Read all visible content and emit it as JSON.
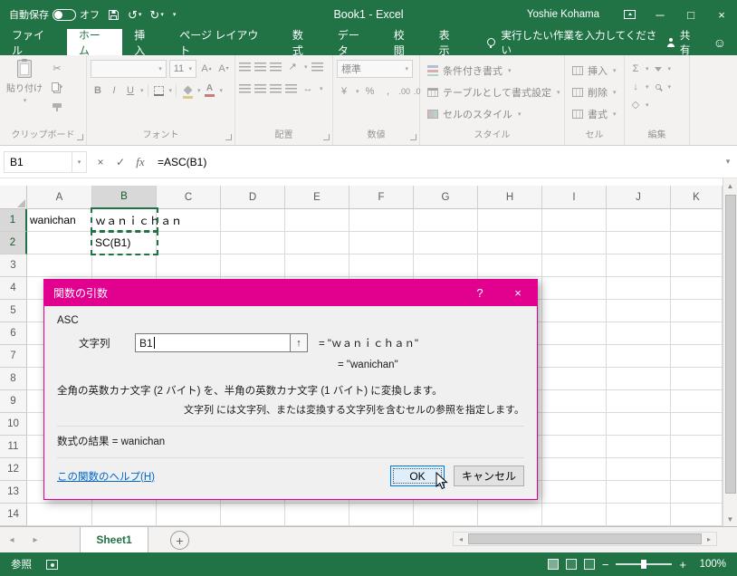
{
  "colors": {
    "excel_green": "#217346",
    "dialog_magenta": "#E2008F",
    "focus_blue": "#0078D7"
  },
  "title_bar": {
    "autosave_label": "自動保存",
    "autosave_state": "オフ",
    "workbook_title": "Book1 - Excel",
    "user_name": "Yoshie Kohama"
  },
  "tabs": {
    "file": "ファイル",
    "items": [
      {
        "label": "ホーム"
      },
      {
        "label": "挿入"
      },
      {
        "label": "ページ レイアウト"
      },
      {
        "label": "数式"
      },
      {
        "label": "データ"
      },
      {
        "label": "校閲"
      },
      {
        "label": "表示"
      }
    ],
    "tell_me": "実行したい作業を入力してください",
    "share": "共有"
  },
  "ribbon": {
    "paste": "貼り付け",
    "font_size": "11",
    "number_format": "標準",
    "style_buttons": [
      "条件付き書式",
      "テーブルとして書式設定",
      "セルのスタイル"
    ],
    "cell_buttons": [
      "挿入",
      "削除",
      "書式"
    ],
    "group_labels": [
      "クリップボード",
      "フォント",
      "配置",
      "数値",
      "スタイル",
      "セル",
      "編集"
    ]
  },
  "formula_bar": {
    "name_box": "B1",
    "fx": "fx",
    "formula": "=ASC(B1)"
  },
  "grid": {
    "columns": [
      "A",
      "B",
      "C",
      "D",
      "E",
      "F",
      "G",
      "H",
      "I",
      "J",
      "K"
    ],
    "row_count": 14,
    "selected_column": "B",
    "selected_rows": [
      1,
      2
    ],
    "cells": {
      "A1": "wanichan",
      "B1": "ｗａｎｉｃｈａｎ",
      "B2": "SC(B1)"
    }
  },
  "dialog": {
    "title": "関数の引数",
    "function_name": "ASC",
    "arg_label": "文字列",
    "arg_value": "B1",
    "arg_result": "=  \"ｗａｎｉｃｈａｎ\"",
    "preview_result": "=  \"wanichan\"",
    "description": "全角の英数カナ文字 (2 バイト) を、半角の英数カナ文字 (1 バイト) に変換します。",
    "arg_help": "文字列  には文字列、または変換する文字列を含むセルの参照を指定します。",
    "result_label": "数式の結果 =  wanichan",
    "help_link": "この関数のヘルプ(H)",
    "ok": "OK",
    "cancel": "キャンセル"
  },
  "sheets": {
    "active": "Sheet1"
  },
  "status_bar": {
    "mode": "参照",
    "zoom": "100%"
  }
}
